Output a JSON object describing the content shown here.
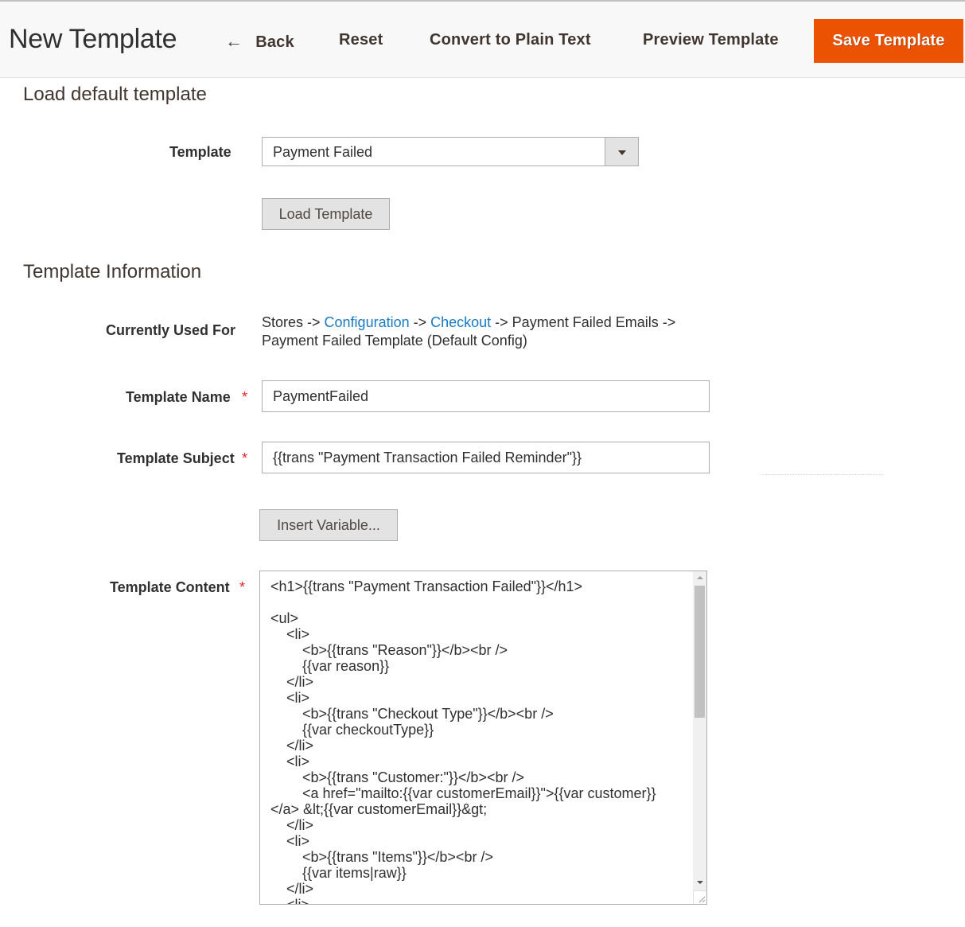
{
  "header": {
    "title": "New Template",
    "actions": {
      "back_icon": "arrow-left-icon",
      "back_arrow": "←",
      "back": "Back",
      "reset": "Reset",
      "convert": "Convert to Plain Text",
      "preview": "Preview Template",
      "save": "Save Template"
    },
    "accent_color": "#eb5202"
  },
  "load_default": {
    "section_title": "Load default template",
    "template_label": "Template",
    "template_selected": "Payment Failed",
    "load_button": "Load Template"
  },
  "info": {
    "section_title": "Template Information",
    "used_for_label": "Currently Used For",
    "used_for": {
      "prefix": "Stores -> ",
      "link1": "Configuration",
      "sep": " -> ",
      "link2": "Checkout",
      "suffix": " -> Payment Failed Emails -> Payment Failed Template  (Default Config)"
    },
    "link_color": "#1979c3",
    "name_label": "Template Name",
    "name_value": "PaymentFailed",
    "subject_label": "Template Subject",
    "subject_value": "{{trans \"Payment Transaction Failed Reminder\"}}",
    "insert_variable_button": "Insert Variable...",
    "content_label": "Template Content",
    "content_value": "<h1>{{trans \"Payment Transaction Failed\"}}</h1>\n\n<ul>\n    <li>\n        <b>{{trans \"Reason\"}}</b><br />\n        {{var reason}}\n    </li>\n    <li>\n        <b>{{trans \"Checkout Type\"}}</b><br />\n        {{var checkoutType}}\n    </li>\n    <li>\n        <b>{{trans \"Customer:\"}}</b><br />\n        <a href=\"mailto:{{var customerEmail}}\">{{var customer}}</a> &lt;{{var customerEmail}}&gt;\n    </li>\n    <li>\n        <b>{{trans \"Items\"}}</b><br />\n        {{var items|raw}}\n    </li>\n    <li>",
    "required_marker": "*"
  }
}
